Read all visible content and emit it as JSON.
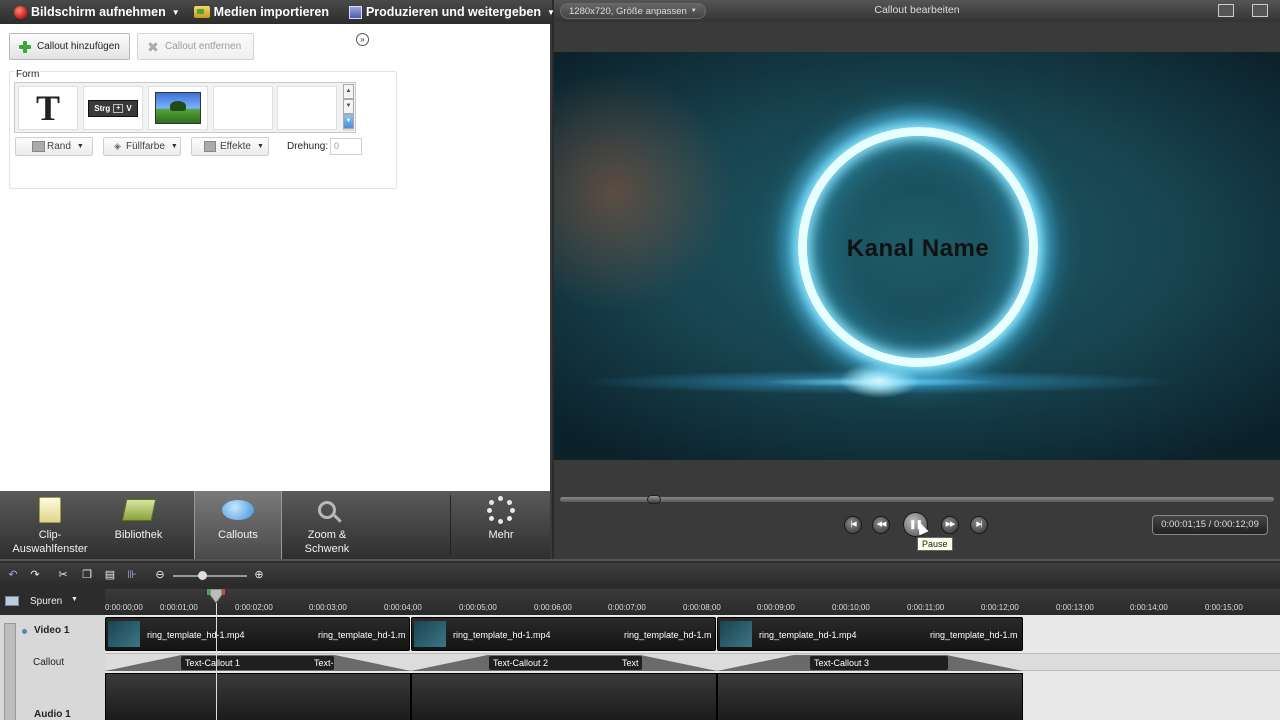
{
  "menubar": {
    "record_label": "Bildschirm aufnehmen",
    "import_label": "Medien importieren",
    "produce_label": "Produzieren und weitergeben"
  },
  "callout_panel": {
    "add_button": "Callout hinzufügen",
    "remove_button": "Callout entfernen",
    "form_label": "Form",
    "shapes": [
      "text-shape",
      "keystroke-shape",
      "image-shape",
      "empty",
      "empty"
    ],
    "keystroke_keys": [
      "Strg",
      "+",
      "V"
    ],
    "border_label": "Rand",
    "fill_label": "Füllfarbe",
    "effects_label": "Effekte",
    "rotation_label": "Drehung:",
    "rotation_value": "0"
  },
  "tabs": [
    {
      "label": "Clip-\nAuswahlfenster",
      "icon": "clip-bin-icon"
    },
    {
      "label": "Bibliothek",
      "icon": "library-icon"
    },
    {
      "label": "Callouts",
      "icon": "callout-icon"
    },
    {
      "label": "Zoom &\nSchwenk",
      "icon": "zoom-icon"
    },
    {
      "label": "Mehr",
      "icon": "more-icon"
    }
  ],
  "preview": {
    "size_label": "1280x720, Größe anpassen",
    "title": "Callout bearbeiten",
    "canvas_text": "Kanal Name",
    "tooltip": "Pause",
    "time": "0:00:01;15 / 0:00:12;09",
    "scrub_position": 0.13
  },
  "timeline": {
    "tracks_label": "Spuren",
    "ticks": [
      "0:00:00;00",
      "0:00:01;00",
      "0:00:02;00",
      "0:00:03;00",
      "0:00:04;00",
      "0:00:05;00",
      "0:00:06;00",
      "0:00:07;00",
      "0:00:08;00",
      "0:00:09;00",
      "0:00:10;00",
      "0:00:11;00",
      "0:00:12;00",
      "0:00:13;00",
      "0:00:14;00",
      "0:00:15;00"
    ],
    "rows": {
      "video": "Video 1",
      "callout": "Callout",
      "audio": "Audio 1"
    },
    "clips": [
      {
        "name_start": "ring_template_hd-1.mp4",
        "name_end": "ring_template_hd-1.m"
      },
      {
        "name_start": "ring_template_hd-1.mp4",
        "name_end": "ring_template_hd-1.m"
      },
      {
        "name_start": "ring_template_hd-1.mp4",
        "name_end": "ring_template_hd-1.m"
      }
    ],
    "callouts": [
      {
        "name": "Text-Callout 1",
        "tail": "Text-"
      },
      {
        "name": "Text-Callout 2",
        "tail": "Text"
      },
      {
        "name": "Text-Callout 3",
        "tail": ""
      }
    ]
  },
  "colors": {
    "accent_blue": "#3c8fdc",
    "record_red": "#d2281a",
    "add_green": "#3aa935"
  }
}
